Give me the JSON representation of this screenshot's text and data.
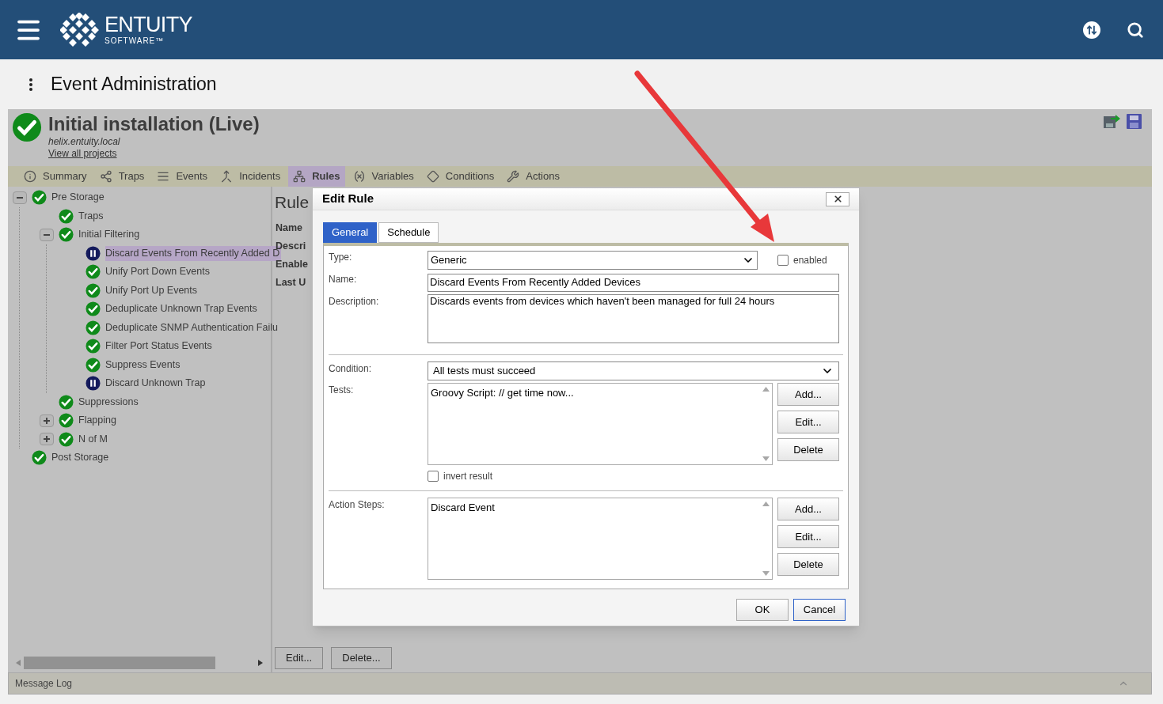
{
  "header": {
    "logo_name": "ENTUITY",
    "logo_sub": "SOFTWARE™"
  },
  "page_title": "Event Administration",
  "project": {
    "title": "Initial installation (Live)",
    "host": "helix.entuity.local",
    "link": "View all projects"
  },
  "nav_tabs": [
    {
      "label": "Summary",
      "selected": false
    },
    {
      "label": "Traps",
      "selected": false
    },
    {
      "label": "Events",
      "selected": false
    },
    {
      "label": "Incidents",
      "selected": false
    },
    {
      "label": "Rules",
      "selected": true
    },
    {
      "label": "Variables",
      "selected": false
    },
    {
      "label": "Conditions",
      "selected": false
    },
    {
      "label": "Actions",
      "selected": false
    }
  ],
  "tree": [
    {
      "label": "Pre Storage",
      "kind": "ok",
      "expanded": true,
      "selected": false,
      "children": [
        {
          "label": "Traps",
          "kind": "ok",
          "selected": false
        },
        {
          "label": "Initial Filtering",
          "kind": "ok",
          "expanded": true,
          "selected": false,
          "children": [
            {
              "label": "Discard Events From Recently Added D",
              "kind": "paused",
              "selected": true
            },
            {
              "label": "Unify Port Down Events",
              "kind": "ok",
              "selected": false
            },
            {
              "label": "Unify Port Up Events",
              "kind": "ok",
              "selected": false
            },
            {
              "label": "Deduplicate Unknown Trap Events",
              "kind": "ok",
              "selected": false
            },
            {
              "label": "Deduplicate SNMP Authentication Failu",
              "kind": "ok",
              "selected": false
            },
            {
              "label": "Filter Port Status Events",
              "kind": "ok",
              "selected": false
            },
            {
              "label": "Suppress Events",
              "kind": "ok",
              "selected": false
            },
            {
              "label": "Discard Unknown Trap",
              "kind": "paused",
              "selected": false
            }
          ]
        },
        {
          "label": "Suppressions",
          "kind": "ok",
          "selected": false
        },
        {
          "label": "Flapping",
          "kind": "ok",
          "expanded": false,
          "selected": false
        },
        {
          "label": "N of M",
          "kind": "ok",
          "expanded": false,
          "selected": false
        }
      ]
    },
    {
      "label": "Post Storage",
      "kind": "ok",
      "selected": false
    }
  ],
  "rule_details": {
    "heading": "Rule",
    "fields": [
      "Name",
      "Descri",
      "Enable",
      "Last U"
    ]
  },
  "panel_buttons": [
    "Edit...",
    "Delete..."
  ],
  "message_log": "Message Log",
  "dialog": {
    "title": "Edit Rule",
    "tabs": [
      {
        "label": "General",
        "selected": true
      },
      {
        "label": "Schedule",
        "selected": false
      }
    ],
    "enabled": {
      "label": "enabled",
      "checked": false
    },
    "type": {
      "label": "Type:",
      "value": "Generic"
    },
    "name": {
      "label": "Name:",
      "value": "Discard Events From Recently Added Devices"
    },
    "description": {
      "label": "Description:",
      "value": "Discards events from devices which haven't been managed for full 24 hours"
    },
    "condition": {
      "label": "Condition:",
      "value": "All tests must succeed"
    },
    "tests": {
      "label": "Tests:",
      "items": [
        "Groovy Script: // get time now..."
      ],
      "buttons": [
        "Add...",
        "Edit...",
        "Delete"
      ]
    },
    "invert": {
      "label": "invert result",
      "checked": false
    },
    "action_steps": {
      "label": "Action Steps:",
      "items": [
        "Discard Event"
      ],
      "buttons": [
        "Add...",
        "Edit...",
        "Delete"
      ]
    },
    "buttons": [
      "OK",
      "Cancel"
    ]
  }
}
